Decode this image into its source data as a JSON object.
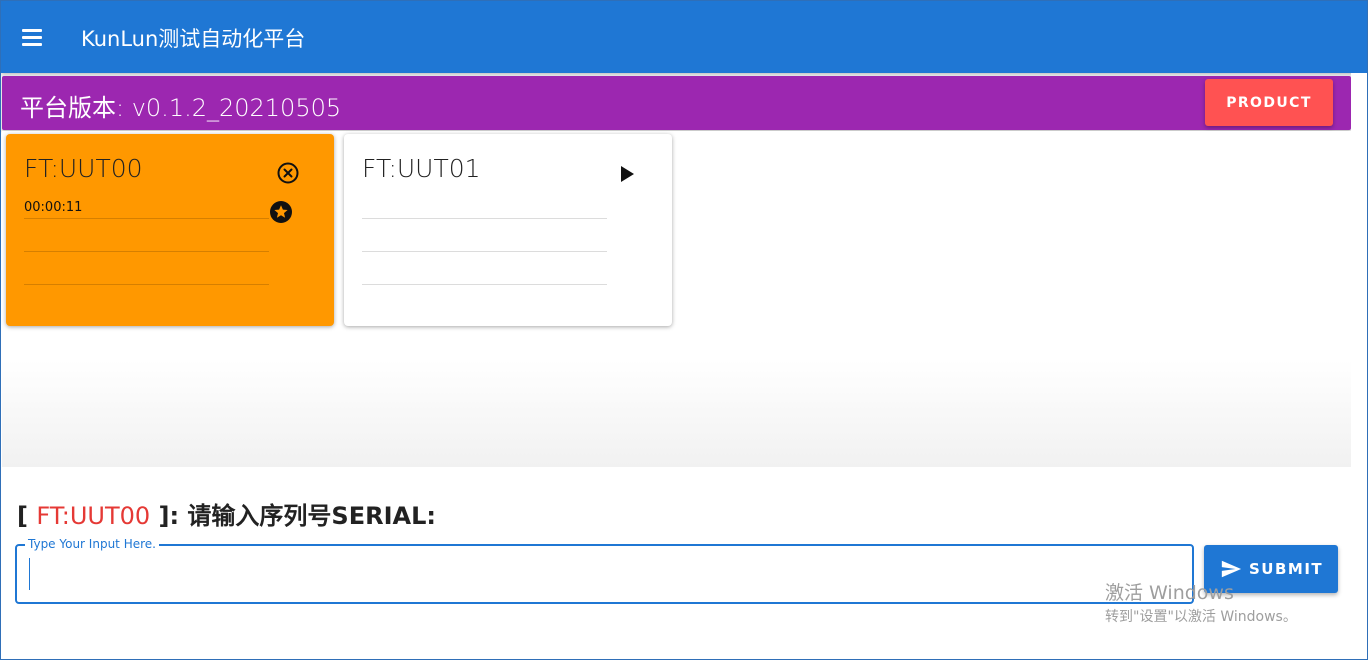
{
  "appbar": {
    "title": "KunLun测试自动化平台",
    "background": "#1f77d4"
  },
  "banner": {
    "version_text": "平台版本: v0.1.2_20210505",
    "product_label": "PRODUCT",
    "background": "#9c27b0",
    "product_color": "#ff5252"
  },
  "cards": [
    {
      "title": "FT:UUT00",
      "timer": "00:00:11",
      "background": "#ff9800",
      "icons": [
        "close-circle-icon",
        "star-circle-icon"
      ]
    },
    {
      "title": "FT:UUT01",
      "background": "#ffffff",
      "icons": [
        "play-icon"
      ]
    }
  ],
  "prompt": {
    "open": "[ ",
    "uut": "FT:UUT00",
    "close": " ]: 请输入序列号SERIAL:"
  },
  "input": {
    "label": "Type Your Input Here.",
    "value": ""
  },
  "submit": {
    "label": "SUBMIT",
    "icon": "send-icon"
  },
  "watermark": {
    "line1": "激活 Windows",
    "line2": "转到\"设置\"以激活 Windows。"
  }
}
